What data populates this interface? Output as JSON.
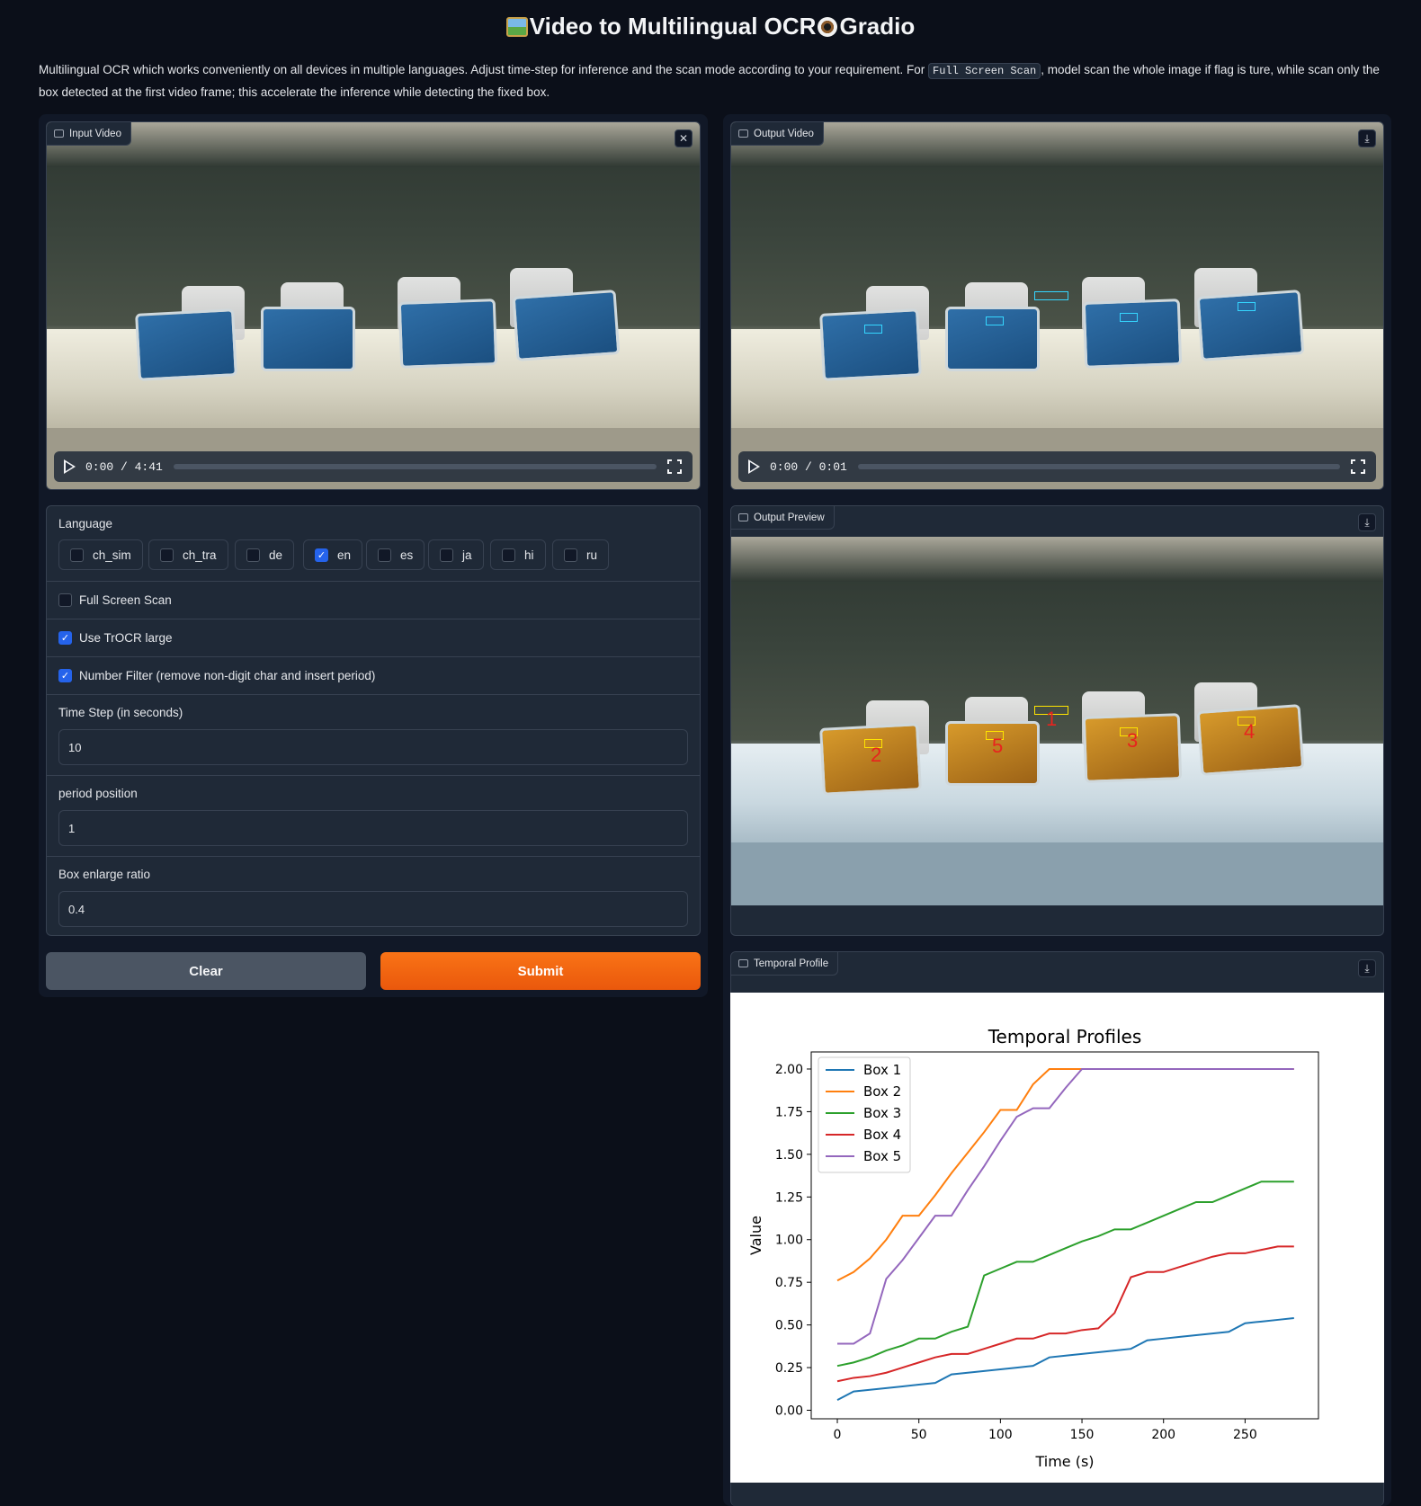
{
  "header": {
    "title": "Video to Multilingual OCR",
    "title_suffix": "Gradio",
    "description_prefix": "Multilingual OCR which works conveniently on all devices in multiple languages. Adjust time-step for inference and the scan mode according to your requirement. For ",
    "description_code": "Full Screen Scan",
    "description_suffix": ", model scan the whole image if flag is ture, while scan only the box detected at the first video frame; this accelerate the inference while detecting the fixed box."
  },
  "input_video": {
    "label": "Input Video",
    "time": "0:00 / 4:41",
    "close_icon": "close-icon"
  },
  "output_video": {
    "label": "Output Video",
    "time": "0:00 / 0:01",
    "download_icon": "download-icon"
  },
  "output_preview": {
    "label": "Output Preview"
  },
  "temporal_profile": {
    "label": "Temporal Profile"
  },
  "form": {
    "language_label": "Language",
    "languages": [
      {
        "label": "ch_sim",
        "checked": false
      },
      {
        "label": "ch_tra",
        "checked": false
      },
      {
        "label": "de",
        "checked": false
      },
      {
        "label": "en",
        "checked": true
      },
      {
        "label": "es",
        "checked": false
      },
      {
        "label": "ja",
        "checked": false
      },
      {
        "label": "hi",
        "checked": false
      },
      {
        "label": "ru",
        "checked": false
      }
    ],
    "full_screen_scan": {
      "label": "Full Screen Scan",
      "checked": false
    },
    "use_trocr": {
      "label": "Use TrOCR large",
      "checked": true
    },
    "number_filter": {
      "label": "Number Filter (remove non-digit char and insert period)",
      "checked": true
    },
    "time_step": {
      "label": "Time Step (in seconds)",
      "value": "10"
    },
    "period_position": {
      "label": "period position",
      "value": "1"
    },
    "box_enlarge": {
      "label": "Box enlarge ratio",
      "value": "0.4"
    },
    "clear_label": "Clear",
    "submit_label": "Submit"
  },
  "colors": {
    "background": "#0b0f19",
    "panel": "#111827",
    "block": "#1f2937",
    "border": "#374151",
    "accent": "#f97316",
    "checkbox": "#2563eb"
  },
  "chart_data": {
    "type": "line",
    "title": "Temporal Profiles",
    "xlabel": "Time (s)",
    "ylabel": "Value",
    "xlim": [
      -16,
      295
    ],
    "ylim": [
      -0.05,
      2.1
    ],
    "xticks": [
      0,
      50,
      100,
      150,
      200,
      250
    ],
    "yticks": [
      "0.00",
      "0.25",
      "0.50",
      "0.75",
      "1.00",
      "1.25",
      "1.50",
      "1.75",
      "2.00"
    ],
    "legend_position": "upper-left",
    "x": [
      0,
      10,
      20,
      30,
      40,
      50,
      60,
      70,
      80,
      90,
      100,
      110,
      120,
      130,
      140,
      150,
      160,
      170,
      180,
      190,
      200,
      210,
      220,
      230,
      240,
      250,
      260,
      270,
      280
    ],
    "series": [
      {
        "name": "Box 1",
        "color": "#1f77b4",
        "values": [
          0.06,
          0.11,
          0.12,
          0.13,
          0.14,
          0.15,
          0.16,
          0.21,
          0.22,
          0.23,
          0.24,
          0.25,
          0.26,
          0.31,
          0.32,
          0.33,
          0.34,
          0.35,
          0.36,
          0.41,
          0.42,
          0.43,
          0.44,
          0.45,
          0.46,
          0.51,
          0.52,
          0.53,
          0.54
        ]
      },
      {
        "name": "Box 2",
        "color": "#ff7f0e",
        "values": [
          0.76,
          0.81,
          0.89,
          1.0,
          1.14,
          1.14,
          1.26,
          1.39,
          1.51,
          1.63,
          1.76,
          1.76,
          1.91,
          2.0,
          2.0,
          2.0,
          2.0,
          2.0,
          2.0,
          2.0,
          2.0,
          2.0,
          2.0,
          2.0,
          2.0,
          2.0,
          2.0,
          2.0,
          2.0
        ]
      },
      {
        "name": "Box 3",
        "color": "#2ca02c",
        "values": [
          0.26,
          0.28,
          0.31,
          0.35,
          0.38,
          0.42,
          0.42,
          0.46,
          0.49,
          0.79,
          0.83,
          0.87,
          0.87,
          0.91,
          0.95,
          0.99,
          1.02,
          1.06,
          1.06,
          1.1,
          1.14,
          1.18,
          1.22,
          1.22,
          1.26,
          1.3,
          1.34,
          1.34,
          1.34
        ]
      },
      {
        "name": "Box 4",
        "color": "#d62728",
        "values": [
          0.17,
          0.19,
          0.2,
          0.22,
          0.25,
          0.28,
          0.31,
          0.33,
          0.33,
          0.36,
          0.39,
          0.42,
          0.42,
          0.45,
          0.45,
          0.47,
          0.48,
          0.57,
          0.78,
          0.81,
          0.81,
          0.84,
          0.87,
          0.9,
          0.92,
          0.92,
          0.94,
          0.96,
          0.96
        ]
      },
      {
        "name": "Box 5",
        "color": "#9467bd",
        "values": [
          0.39,
          0.39,
          0.45,
          0.77,
          0.88,
          1.01,
          1.14,
          1.14,
          1.29,
          1.43,
          1.58,
          1.72,
          1.77,
          1.77,
          1.89,
          2.0,
          2.0,
          2.0,
          2.0,
          2.0,
          2.0,
          2.0,
          2.0,
          2.0,
          2.0,
          2.0,
          2.0,
          2.0,
          2.0
        ]
      }
    ]
  }
}
